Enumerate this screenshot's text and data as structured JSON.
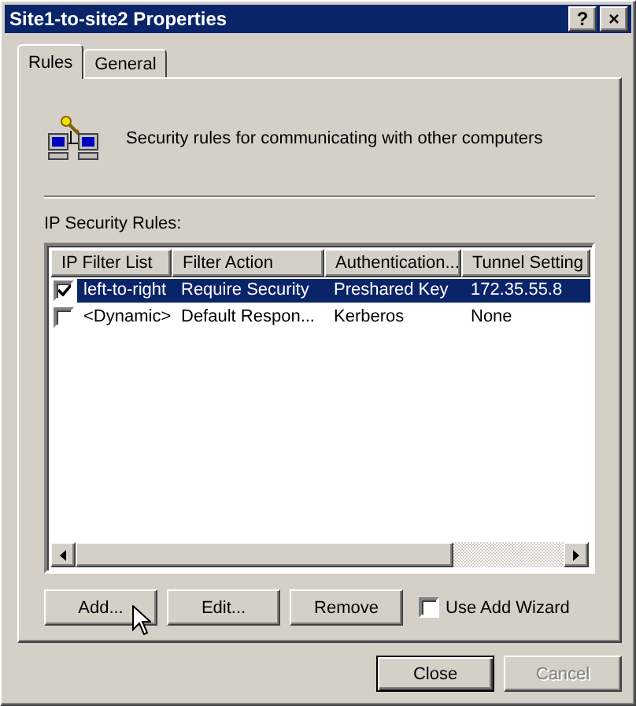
{
  "window": {
    "title": "Site1-to-site2 Properties",
    "title_buttons": [
      "?",
      "×"
    ]
  },
  "tabs": [
    {
      "label": "Rules",
      "selected": true
    },
    {
      "label": "General",
      "selected": false
    }
  ],
  "description": "Security rules for communicating with other computers",
  "rules_label": "IP Security Rules:",
  "table": {
    "columns": [
      "IP Filter List",
      "Filter Action",
      "Authentication...",
      "Tunnel Setting"
    ],
    "rows": [
      {
        "checked": true,
        "selected": true,
        "cells": [
          "left-to-right",
          "Require Security",
          "Preshared Key",
          "172.35.55.8"
        ]
      },
      {
        "checked": false,
        "selected": false,
        "cells": [
          "<Dynamic>",
          "Default Respon...",
          "Kerberos",
          "None"
        ]
      }
    ]
  },
  "actions": [
    {
      "label": "Add...",
      "hovered": true
    },
    {
      "label": "Edit...",
      "hovered": false
    },
    {
      "label": "Remove",
      "hovered": false
    }
  ],
  "wizard": {
    "label": "Use Add Wizard",
    "checked": false
  },
  "footer": [
    {
      "label": "Close",
      "disabled": false
    },
    {
      "label": "Cancel",
      "disabled": true
    }
  ]
}
